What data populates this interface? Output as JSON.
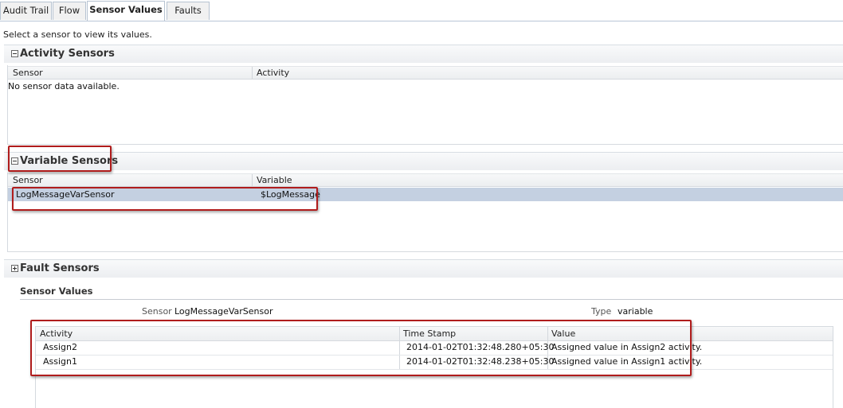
{
  "tabs": [
    {
      "label": "Audit Trail"
    },
    {
      "label": "Flow"
    },
    {
      "label": "Sensor Values"
    },
    {
      "label": "Faults"
    }
  ],
  "instruction": "Select a sensor to view its values.",
  "activity_sensors": {
    "title": "Activity Sensors",
    "columns": [
      "Sensor",
      "Activity"
    ],
    "empty_message": "No sensor data available."
  },
  "variable_sensors": {
    "title": "Variable Sensors",
    "columns": [
      "Sensor",
      "Variable"
    ],
    "rows": [
      {
        "sensor": "LogMessageVarSensor",
        "variable": "$LogMessage"
      }
    ]
  },
  "fault_sensors": {
    "title": "Fault Sensors"
  },
  "sensor_values": {
    "title": "Sensor Values",
    "sensor_label": "Sensor",
    "sensor_value": "LogMessageVarSensor",
    "type_label": "Type",
    "type_value": "variable",
    "columns": [
      "Activity",
      "Time Stamp",
      "Value"
    ],
    "rows": [
      {
        "activity": "Assign2",
        "timestamp": "2014-01-02T01:32:48.280+05:30",
        "value": "Assigned value in Assign2 activity."
      },
      {
        "activity": "Assign1",
        "timestamp": "2014-01-02T01:32:48.238+05:30",
        "value": "Assigned value in Assign1 activity."
      }
    ]
  },
  "colors": {
    "highlight": "#b01c1c",
    "selected_row": "#c4d0e1"
  },
  "icons": {
    "collapse": "minus-box-icon",
    "expand": "plus-box-icon"
  }
}
